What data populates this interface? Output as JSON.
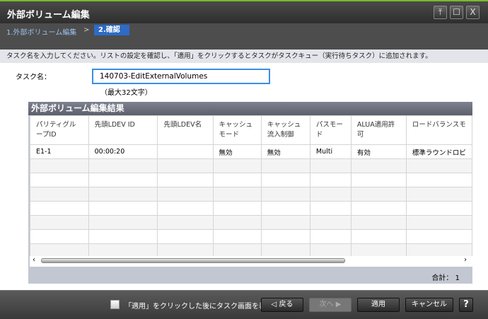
{
  "window": {
    "title": "外部ボリューム編集",
    "buttons": [
      "pin",
      "maximize",
      "close"
    ]
  },
  "steps": [
    {
      "label": "1.外部ボリューム編集"
    },
    {
      "label": "2.確認",
      "active": true
    }
  ],
  "step_separator": ">",
  "instruction": "タスク名を入力してください。リストの設定を確認し、「適用」をクリックするとタスクがタスクキュー（実行待ちタスク）に追加されます。",
  "task": {
    "label": "タスク名：",
    "value": "140703-EditExternalVolumes",
    "hint": "（最大32文字）"
  },
  "results": {
    "title": "外部ボリューム編集結果",
    "columns": [
      "パリティグループID",
      "先頭LDEV ID",
      "先頭LDEV名",
      "キャッシュモード",
      "キャッシュ流入制御",
      "パスモード",
      "ALUA適用許可",
      "ロードバランスモ"
    ],
    "rows": [
      [
        "E1-1",
        "00:00:20",
        "",
        "無効",
        "無効",
        "Multi",
        "有効",
        "標準ラウンドロビ"
      ]
    ],
    "total_label": "合計：",
    "total": "1"
  },
  "footer": {
    "checkbox_label": "「適用」をクリックした後にタスク画面を表示",
    "checked": false,
    "back": "戻る",
    "next": "次へ",
    "apply": "適用",
    "cancel": "キャンセル",
    "help": "?"
  }
}
